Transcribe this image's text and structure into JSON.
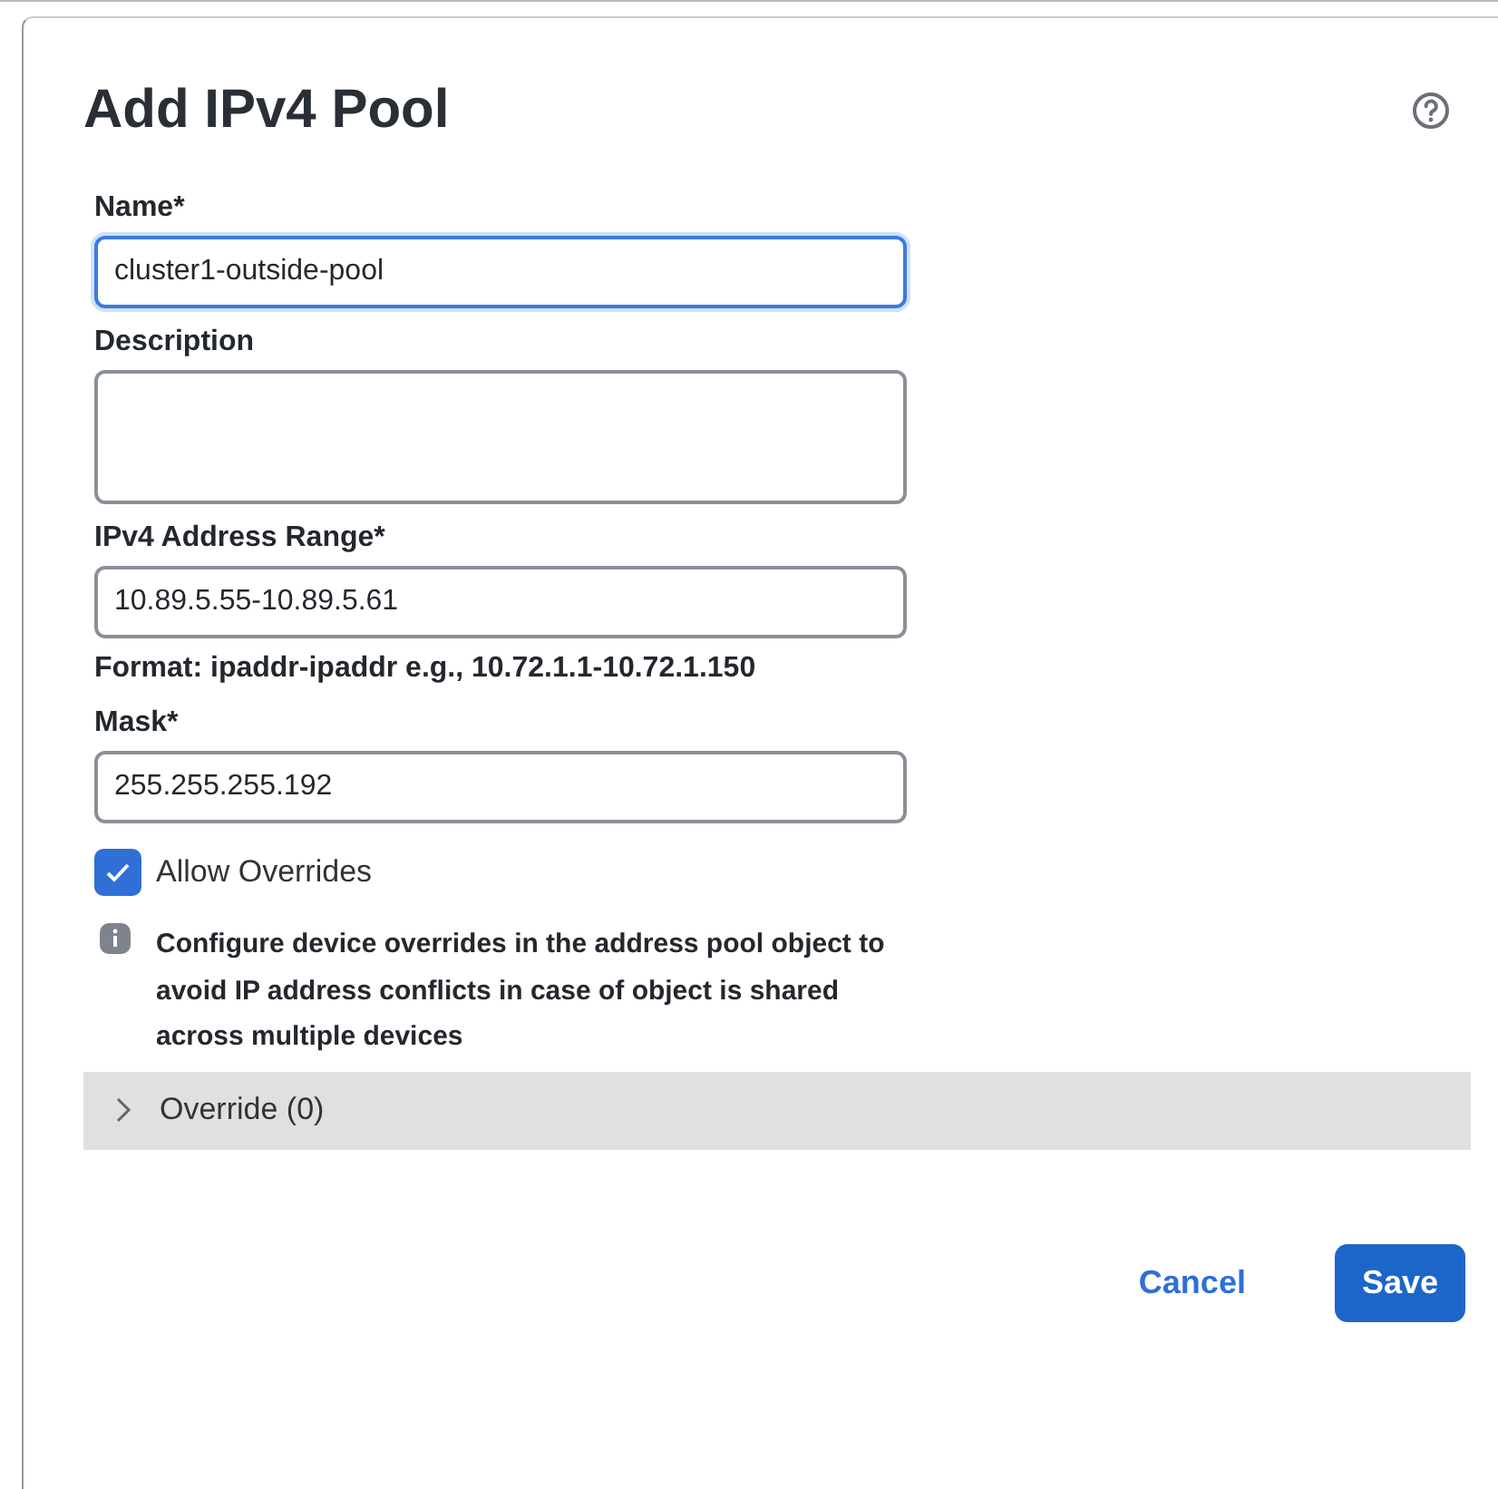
{
  "dialog": {
    "title": "Add IPv4 Pool"
  },
  "fields": [
    {
      "kind": "input",
      "label": "Name*",
      "value": "cluster1-outside-pool",
      "focused": true
    },
    {
      "kind": "textarea",
      "label": "Description",
      "focused": false
    },
    {
      "kind": "input",
      "label": "IPv4 Address Range*",
      "value": "10.89.5.55-10.89.5.61",
      "focused": false,
      "hint": "Format: ipaddr-ipaddr e.g., 10.72.1.1-10.72.1.150"
    },
    {
      "kind": "input",
      "label": "Mask*",
      "value": "255.255.255.192",
      "focused": false
    }
  ],
  "allow_overrides": {
    "label": "Allow Overrides",
    "checked": true
  },
  "info": "Configure device overrides in the address pool object to avoid IP address conflicts in case of object is shared across multiple devices",
  "override_section": {
    "label": "Override (0)",
    "expanded": false
  },
  "buttons": [
    {
      "kind": "secondary",
      "label": "Cancel"
    },
    {
      "kind": "primary",
      "label": "Save"
    }
  ]
}
